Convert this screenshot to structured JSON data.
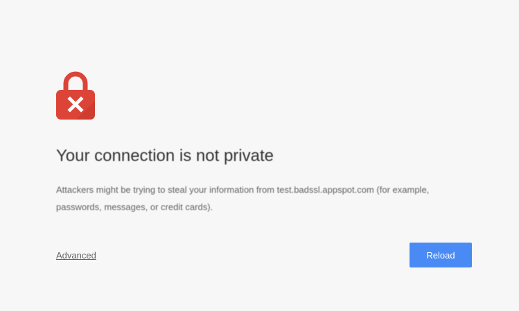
{
  "interstitial": {
    "icon": "lock-error-icon",
    "title": "Your connection is not private",
    "description": "Attackers might be trying to steal your information from test.badssl.appspot.com (for example, passwords, messages, or credit cards).",
    "advanced_label": "Advanced",
    "reload_label": "Reload"
  },
  "colors": {
    "background": "#f7f7f7",
    "lock_red": "#db4437",
    "button_blue": "#4a8af4"
  }
}
